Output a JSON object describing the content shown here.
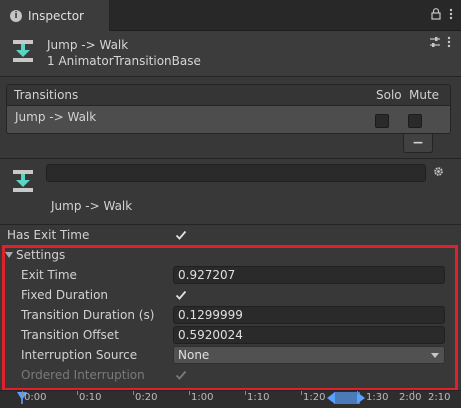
{
  "tab": {
    "title": "Inspector"
  },
  "header": {
    "title": "Jump -> Walk",
    "subtitle": "1 AnimatorTransitionBase"
  },
  "transitions": {
    "header_label": "Transitions",
    "solo_label": "Solo",
    "mute_label": "Mute",
    "rows": [
      {
        "name": "Jump -> Walk",
        "solo": false,
        "mute": false
      }
    ],
    "remove_label": "−"
  },
  "transition_detail": {
    "name_value": "",
    "display_name": "Jump -> Walk"
  },
  "properties": {
    "has_exit_time_label": "Has Exit Time",
    "has_exit_time": true,
    "settings_label": "Settings",
    "exit_time_label": "Exit Time",
    "exit_time_value": "0.927207",
    "fixed_duration_label": "Fixed Duration",
    "fixed_duration": true,
    "transition_duration_label": "Transition Duration (s)",
    "transition_duration_value": "0.1299999",
    "transition_offset_label": "Transition Offset",
    "transition_offset_value": "0.5920024",
    "interruption_source_label": "Interruption Source",
    "interruption_source_value": "None",
    "ordered_interruption_label": "Ordered Interruption",
    "ordered_interruption": true
  },
  "timeline": {
    "ticks": [
      "0:00",
      "0:10",
      "0:20",
      "1:00",
      "1:10",
      "1:20",
      "1:30",
      "2:00",
      "2:10"
    ]
  },
  "colors": {
    "highlight": "#e0202a",
    "accent": "#4a7ab8"
  }
}
